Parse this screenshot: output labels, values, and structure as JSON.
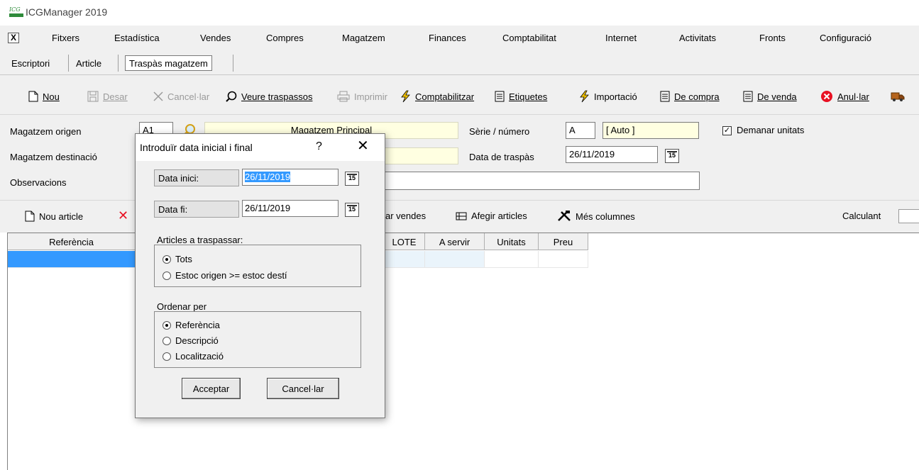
{
  "window": {
    "title": "ICGManager 2019",
    "logo_text": "ICG"
  },
  "menu": {
    "close_glyph": "X",
    "items": [
      "Fitxers",
      "Estadística",
      "Vendes",
      "Compres",
      "Magatzem",
      "Finances",
      "Comptabilitat",
      "Internet",
      "Activitats",
      "Fronts",
      "Configuració"
    ]
  },
  "tabs": [
    "Escriptori",
    "Article",
    "Traspàs magatzem"
  ],
  "toolbar": {
    "nou": "Nou",
    "desar": "Desar",
    "cancelar": "Cancel·lar",
    "veure_traspassos": "Veure traspassos",
    "imprimir": "Imprimir",
    "comptabilitzar": "Comptabilitzar",
    "etiquetes": "Etiquetes",
    "importacio": "Importació",
    "de_compra": "De compra",
    "de_venda": "De venda",
    "anular": "Anul·lar"
  },
  "form": {
    "magatzem_origen_label": "Magatzem origen",
    "magatzem_origen_code": "A1",
    "magatzem_origen_name": "Magatzem Principal",
    "magatzem_desti_label": "Magatzem destinació",
    "observacions_label": "Observacions",
    "serie_label": "Sèrie / número",
    "serie_value": "A",
    "numero_value": "[ Auto ]",
    "data_traspas_label": "Data de traspàs",
    "data_traspas_value": "26/11/2019",
    "demanar_unitats_label": "Demanar unitats",
    "demanar_unitats_checked": true,
    "calendar_glyph": "15"
  },
  "linebar": {
    "nou_article": "Nou article",
    "delete_glyph": "✕",
    "ar_vendes": "ar vendes",
    "afegir_articles": "Afegir articles",
    "mes_columnes": "Més columnes",
    "calculant": "Calculant"
  },
  "grid": {
    "columns": [
      "Referència",
      "LOTE",
      "A servir",
      "Unitats",
      "Preu"
    ]
  },
  "dialog": {
    "title": "Introduïr data inicial i final",
    "help": "?",
    "close": "✕",
    "data_inici_label": "Data inici:",
    "data_inici_value": "26/11/2019",
    "data_fi_label": "Data fi:",
    "data_fi_value": "26/11/2019",
    "articles_group_label": "Articles a traspassar:",
    "articles_options": [
      "Tots",
      "Estoc origen >= estoc destí"
    ],
    "articles_selected": "Tots",
    "ordenar_group_label": "Ordenar per",
    "ordenar_options": [
      "Referència",
      "Descripció",
      "Localització"
    ],
    "ordenar_selected": "Referència",
    "acceptar": "Acceptar",
    "cancelar": "Cancel·lar"
  },
  "colors": {
    "selection": "#3399ff",
    "readonly_field": "#ffffe1",
    "panel": "#f0f0f0",
    "delete_red": "#e81123",
    "logo_green": "#2e8b3a"
  }
}
